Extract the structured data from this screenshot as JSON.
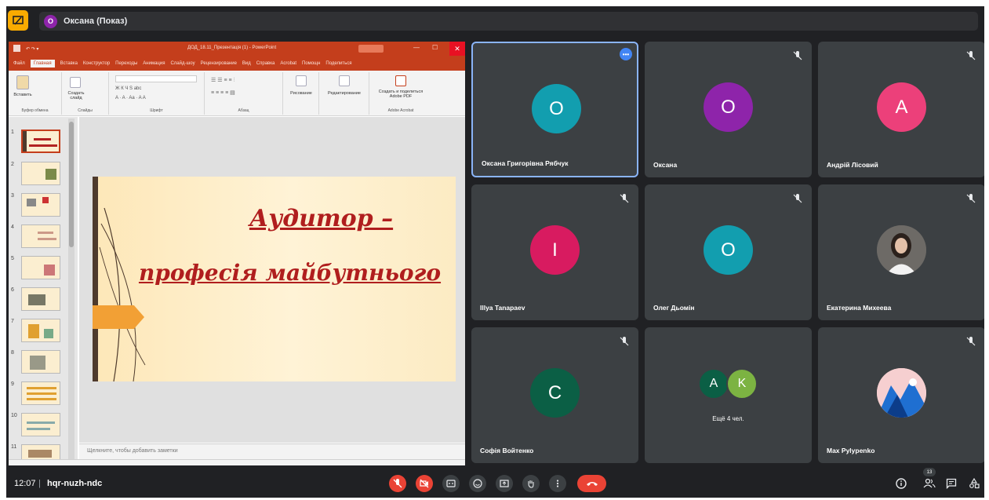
{
  "top": {
    "presenter_initial": "O",
    "presenter_label": "Оксана (Показ)"
  },
  "powerpoint": {
    "window_title": "ДОД_18.11_Презентація (1) - PowerPoint",
    "tabs": [
      "Файл",
      "Главная",
      "Вставка",
      "Конструктор",
      "Переходы",
      "Анимация",
      "Слайд-шоу",
      "Рецензирование",
      "Вид",
      "Справка",
      "Acrobat",
      "Помощн",
      "Поделиться"
    ],
    "ribbon": {
      "paste": "Вставить",
      "clipboard": "Буфер обмена",
      "new_slide": "Создать слайд",
      "slides": "Слайды",
      "font": "Шрифт",
      "paragraph": "Абзац",
      "drawing": "Рисование",
      "editing": "Редактирование",
      "create_share": "Создать и поделиться Adobe PDF",
      "adobe": "Adobe Acrobat"
    },
    "thumb_numbers": [
      "1",
      "2",
      "3",
      "4",
      "5",
      "6",
      "7",
      "8",
      "9",
      "10",
      "11"
    ],
    "slide": {
      "title_line1": "Аудитор –",
      "title_line2": "професія майбутнього"
    },
    "notes_placeholder": "Щелкните, чтобы добавить заметки"
  },
  "participants": [
    {
      "name": "Оксана Григорівна Рябчук",
      "initial": "O",
      "color": "#129eaf"
    },
    {
      "name": "Оксана",
      "initial": "O",
      "color": "#8e24aa"
    },
    {
      "name": "Андрій Лісовий",
      "initial": "A",
      "color": "#ec407a"
    },
    {
      "name": "Illya Tanapaev",
      "initial": "I",
      "color": "#d81b60"
    },
    {
      "name": "Олег Дьомін",
      "initial": "O",
      "color": "#129eaf"
    },
    {
      "name": "Екатерина Михеева",
      "initial": "",
      "color": "#3c4043"
    },
    {
      "name": "Софія Войтенко",
      "initial": "C",
      "color": "#0b5f45"
    },
    {
      "name": "",
      "initial": "",
      "color": "#3c4043"
    },
    {
      "name": "Max Pylypenko",
      "initial": "",
      "color": "#3c4043"
    }
  ],
  "more_tile": {
    "avatars": [
      {
        "initial": "A",
        "color": "#0b5f45"
      },
      {
        "initial": "K",
        "color": "#7cb342"
      }
    ],
    "label": "Ещё 4 чел."
  },
  "bottom": {
    "time": "12:07",
    "separator": "|",
    "meeting_code": "hqr-nuzh-ndc",
    "people_count": "13"
  }
}
